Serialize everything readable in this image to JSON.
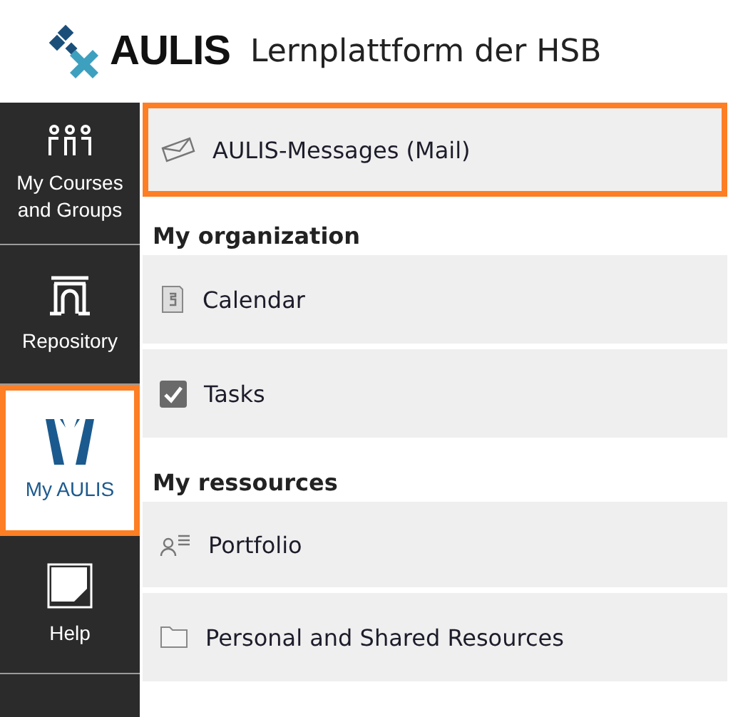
{
  "header": {
    "logo_text": "AULIS",
    "title": "Lernplattform der HSB"
  },
  "sidebar": {
    "items": [
      {
        "label": "My Courses and Groups",
        "selected": false
      },
      {
        "label": "Repository",
        "selected": false
      },
      {
        "label": "My AULIS",
        "selected": true
      },
      {
        "label": "Help",
        "selected": false
      }
    ]
  },
  "menu": [
    {
      "kind": "item",
      "label": "AULIS-Messages (Mail)",
      "highlighted": true
    },
    {
      "kind": "heading",
      "label": "My organization"
    },
    {
      "kind": "item",
      "label": "Calendar",
      "highlighted": false
    },
    {
      "kind": "item",
      "label": "Tasks",
      "highlighted": false
    },
    {
      "kind": "heading",
      "label": "My ressources"
    },
    {
      "kind": "item",
      "label": "Portfolio",
      "highlighted": false
    },
    {
      "kind": "item",
      "label": "Personal and Shared Resources",
      "highlighted": false
    }
  ]
}
